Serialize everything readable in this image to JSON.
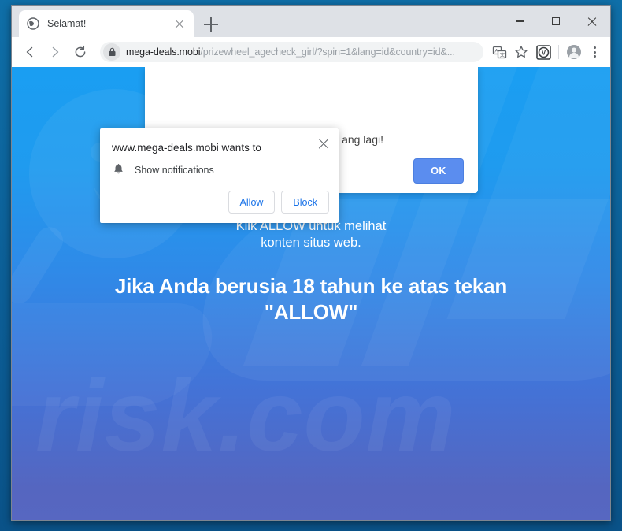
{
  "browser": {
    "tab": {
      "title": "Selamat!",
      "favicon": "globe-icon",
      "close_label": "close-tab"
    },
    "new_tab_label": "+",
    "window_controls": {
      "minimize": "minimize",
      "maximize": "maximize",
      "close": "close"
    },
    "toolbar": {
      "back": "back-arrow-icon",
      "forward": "forward-arrow-icon",
      "reload": "reload-icon",
      "url_host": "mega-deals.mobi",
      "url_path": "/prizewheel_agecheck_girl/?spin=1&lang=id&country=id&...",
      "lock_icon": "lock-icon",
      "translate_icon": "translate-icon",
      "bookmark_icon": "star-icon",
      "extension_icon": "extension-v-icon",
      "profile_icon": "profile-avatar-icon",
      "menu_icon": "three-dot-menu-icon"
    }
  },
  "permission_dialog": {
    "title": "www.mega-deals.mobi wants to",
    "option_icon": "bell-icon",
    "option_label": "Show notifications",
    "allow_label": "Allow",
    "block_label": "Block",
    "close_label": "×",
    "accent_color": "#1a73e8"
  },
  "page": {
    "modal": {
      "partial_text": "ang lagi!",
      "ok_label": "OK",
      "ok_color": "#5b8def"
    },
    "subtitle_line1": "Klik ALLOW untuk melihat",
    "subtitle_line2": "konten situs web.",
    "headline_line1": "Jika Anda berusia 18 tahun ke atas tekan",
    "headline_line2": "\"ALLOW\"",
    "watermark_text": "risk.com",
    "background_top_color": "#1a9ef2",
    "background_bottom_color": "#5566c0"
  }
}
